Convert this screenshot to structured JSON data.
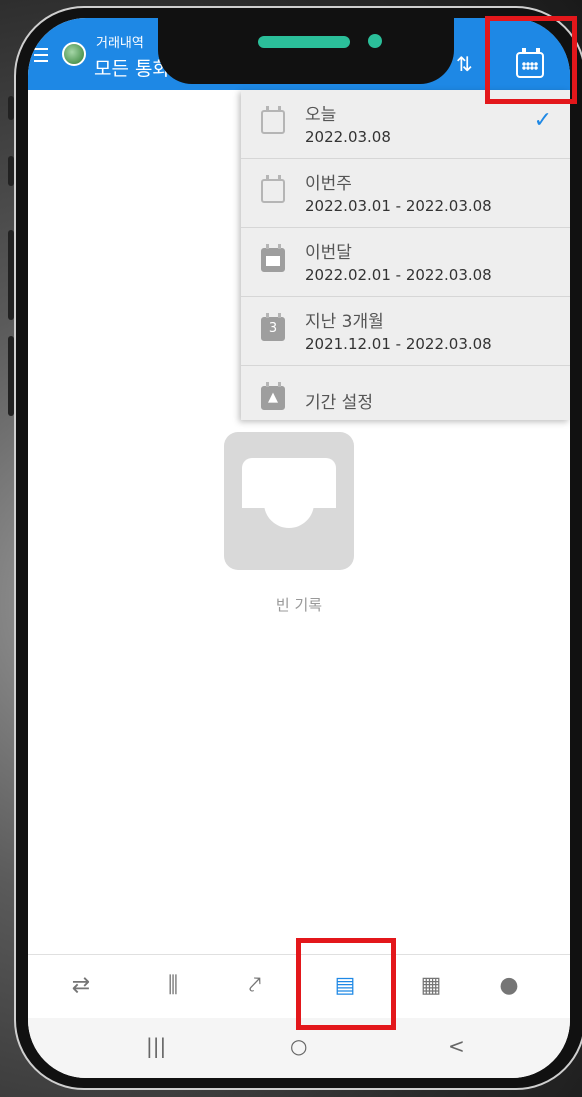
{
  "header": {
    "subtitle": "거래내역",
    "title": "모든 통화"
  },
  "date_menu": {
    "items": [
      {
        "label": "오늘",
        "range": "2022.03.08",
        "selected": true
      },
      {
        "label": "이번주",
        "range": "2022.03.01 - 2022.03.08",
        "selected": false
      },
      {
        "label": "이번달",
        "range": "2022.02.01 - 2022.03.08",
        "selected": false
      },
      {
        "label": "지난 3개월",
        "range": "2021.12.01 - 2022.03.08",
        "selected": false
      },
      {
        "label": "기간 설정",
        "range": "",
        "selected": false
      }
    ],
    "check_glyph": "✓",
    "quarter_badge": "3"
  },
  "empty_state": {
    "text": "빈 기록"
  },
  "bottom_nav": {
    "items": [
      "quotes-icon",
      "chart-icon",
      "trade-icon",
      "history-icon",
      "news-icon",
      "messages-icon"
    ],
    "active": "history-icon"
  },
  "system_nav": {
    "recent": "|||",
    "home": "○",
    "back": "<"
  },
  "colors": {
    "accent": "#1e88e5",
    "highlight": "#e3171b"
  }
}
